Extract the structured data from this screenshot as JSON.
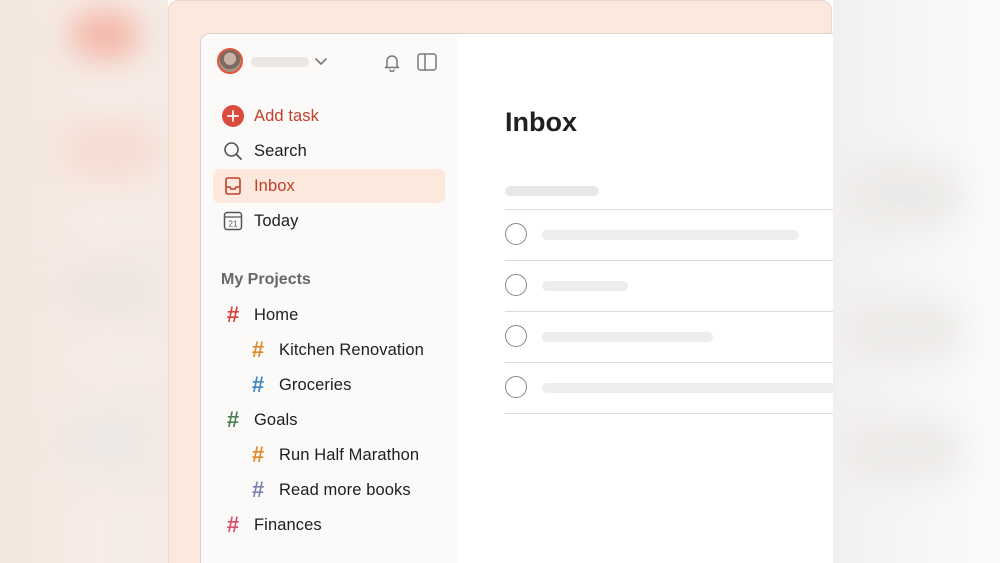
{
  "sidebar": {
    "primary": [
      {
        "label": "Add task",
        "icon": "add-circle-icon",
        "accent": "#db4c3f"
      },
      {
        "label": "Search",
        "icon": "search-icon"
      },
      {
        "label": "Inbox",
        "icon": "inbox-icon",
        "active": true
      },
      {
        "label": "Today",
        "icon": "calendar-icon",
        "day": "21"
      }
    ],
    "section_title": "My Projects",
    "projects": [
      {
        "label": "Home",
        "color": "#db4035",
        "level": 0
      },
      {
        "label": "Kitchen Renovation",
        "color": "#e0892e",
        "level": 1
      },
      {
        "label": "Groceries",
        "color": "#3d86c6",
        "level": 1
      },
      {
        "label": "Goals",
        "color": "#4f7f57",
        "level": 0
      },
      {
        "label": "Run Half Marathon",
        "color": "#e0892e",
        "level": 1
      },
      {
        "label": "Read more books",
        "color": "#7d80b3",
        "level": 1
      },
      {
        "label": "Finances",
        "color": "#d9506a",
        "level": 0
      }
    ]
  },
  "main": {
    "title": "Inbox",
    "tasks_count": 4
  },
  "colors": {
    "accent": "#db4c3f",
    "frame_bg": "#fce8dd",
    "sidebar_bg": "#fcfaf8"
  }
}
